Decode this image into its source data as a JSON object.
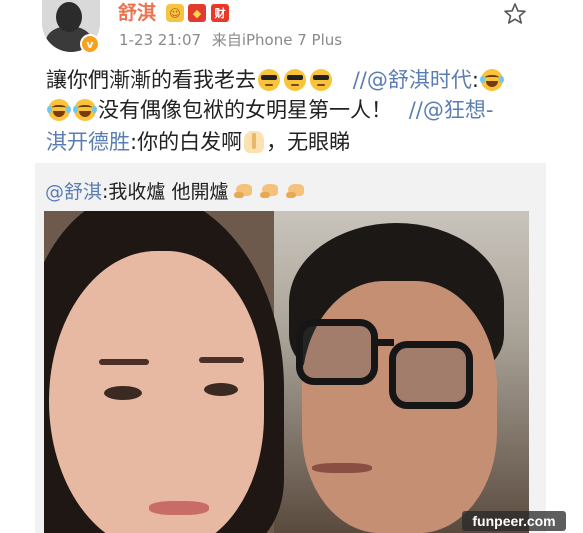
{
  "post": {
    "username": "舒淇",
    "badges": [
      "member-badge",
      "redpacket-badge",
      "cai-badge"
    ],
    "badge_cai_text": "财",
    "verified_mark": "v",
    "timestamp": "1-23 21:07",
    "source": "来自iPhone 7 Plus",
    "text_line1_main": "讓你們漸漸的看我老去",
    "text_line1_sep": "//",
    "text_line1_mention": "@舒淇时代",
    "text_line1_colon": ":",
    "text_line2_main": "没有偶像包袱的女明星第一人！",
    "text_line2_sep": "//",
    "text_line2_mention_a": "@狂想-",
    "text_line3_mention_b": "淇开德胜",
    "text_line3_main": ":你的白发啊",
    "text_line3_tail": "，无眼睇"
  },
  "repost": {
    "mention": "@舒淇",
    "text": ":我收爐 他開爐"
  },
  "watermark": "funpeer.com",
  "colors": {
    "username": "#eb7350",
    "link": "#5a7eb3",
    "repost_bg": "#f2f2f2",
    "meta": "#8a8a8a"
  },
  "icons": [
    "star-icon",
    "cool-face-emoji",
    "laugh-cry-emoji",
    "pray-emoji",
    "muscle-emoji"
  ]
}
